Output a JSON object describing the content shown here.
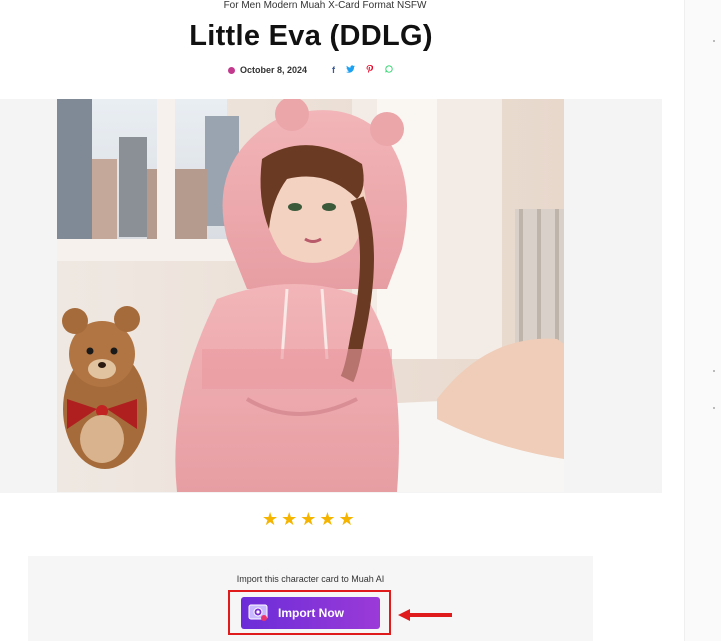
{
  "category_line": "For Men Modern Muah X-Card Format NSFW",
  "post": {
    "title": "Little Eva (DDLG)",
    "date": "October 8, 2024",
    "share_icons": [
      "facebook-icon",
      "twitter-icon",
      "pinterest-icon",
      "whatsapp-icon"
    ]
  },
  "rating": {
    "value": 5,
    "max": 5
  },
  "import_section": {
    "prompt": "Import this character card to Muah AI",
    "button_label": "Import Now"
  },
  "colors": {
    "accent_purple": "#7b2fd8",
    "highlight_red": "#e01b1b",
    "star": "#f5b400"
  }
}
